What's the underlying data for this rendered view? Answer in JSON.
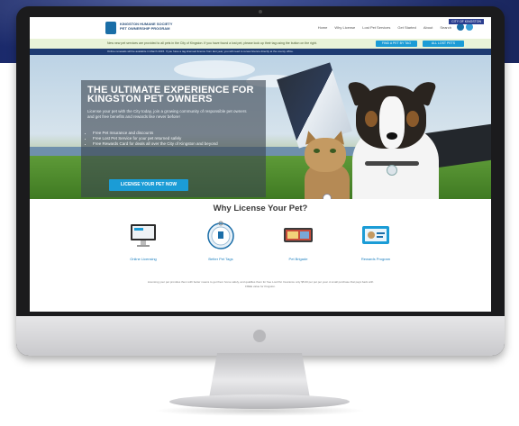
{
  "topbar": {
    "org_name_line1": "KINGSTON HUMANE SOCIETY",
    "org_name_line2": "PET OWNERSHIP PROGRAM",
    "nav": [
      "Home",
      "Why License",
      "Lost Pet Services",
      "Get Started",
      "About",
      "Search"
    ],
    "badge": "CITY OF KINGSTON"
  },
  "alert": {
    "text": "New new pet services are provided to all pets in the City of Kingston. If you have found a lost pet, please look up their tag using the button on the right.",
    "button_1": "FIND A PET BY TAG",
    "button_2": "ALL LOST PETS",
    "subtext": "Online renewals will be available in March 2015. If you have a tag-licensed licence from last year, you will need to renew licence directly at the county office."
  },
  "hero": {
    "title": "THE ULTIMATE EXPERIENCE FOR KINGSTON PET OWNERS",
    "body": "License your pet with the City today, join a growing community of responsible pet owners and get free benefits and rewards like never before!",
    "bullets": [
      "Free Pet Insurance and discounts",
      "Free Lost Pet Service for your pet returned safely",
      "Free Rewards Card for deals all over the City of Kingston and beyond"
    ],
    "cta": "LICENSE YOUR PET NOW"
  },
  "why": {
    "title": "Why License Your Pet?",
    "features": [
      {
        "label": "Online Licensing",
        "icon": "monitor-icon"
      },
      {
        "label": "Better Pet Tags",
        "icon": "pet-tag-icon"
      },
      {
        "label": "Pet Brigade",
        "icon": "brigade-icon"
      },
      {
        "label": "Rewards Program",
        "icon": "rewards-card-icon"
      }
    ],
    "note": "Licensing your pet provides them with better means to get them home safely, and qualifies them for free Lost Pet Insurance only $5.00 per pet per year. A small purchase that pays back with FREE value for Kingston."
  },
  "colors": {
    "brand_blue": "#1b9cd6",
    "navy": "#1d3b72",
    "alert_green": "#e9f3d8"
  }
}
